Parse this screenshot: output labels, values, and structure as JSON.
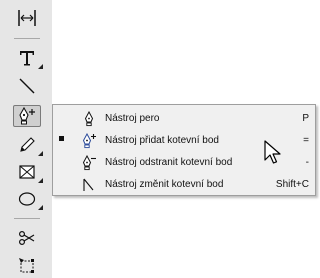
{
  "toolbox": {
    "tools": [
      {
        "name": "gap-tool",
        "icon": "gap-tool-icon"
      },
      {
        "name": "type-tool",
        "icon": "type-tool-icon"
      },
      {
        "name": "line-tool",
        "icon": "line-tool-icon"
      },
      {
        "name": "pen-tool",
        "icon": "pen-add-anchor-icon",
        "active": true
      },
      {
        "name": "pencil-tool",
        "icon": "pencil-icon"
      },
      {
        "name": "rectangle-frame-tool",
        "icon": "rectangle-frame-icon"
      },
      {
        "name": "ellipse-tool",
        "icon": "ellipse-icon"
      },
      {
        "name": "scissors-tool",
        "icon": "scissors-icon"
      },
      {
        "name": "free-transform-tool",
        "icon": "free-transform-icon"
      }
    ]
  },
  "flyout": {
    "items": [
      {
        "label": "Nástroj pero",
        "shortcut": "P",
        "icon": "pen-icon",
        "checked": false
      },
      {
        "label": "Nástroj přidat kotevní bod",
        "shortcut": "=",
        "icon": "add-anchor-point-icon",
        "checked": true
      },
      {
        "label": "Nástroj odstranit kotevní bod",
        "shortcut": "-",
        "icon": "delete-anchor-point-icon",
        "checked": false
      },
      {
        "label": "Nástroj změnit kotevní bod",
        "shortcut": "Shift+C",
        "icon": "convert-anchor-point-icon",
        "checked": false
      }
    ]
  },
  "colors": {
    "toolbox_bg": "#e6e6e6",
    "menu_bg": "#f0f0f0",
    "menu_border": "#9e9e9e"
  }
}
